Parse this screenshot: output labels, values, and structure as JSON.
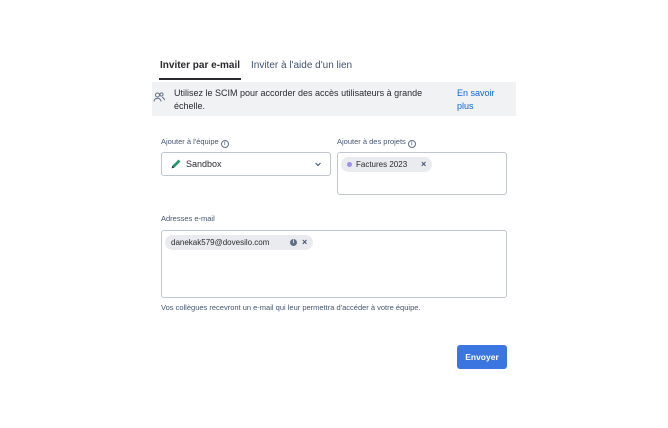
{
  "tabs": [
    {
      "label": "Inviter par e-mail",
      "active": true
    },
    {
      "label": "Inviter à l'aide d'un lien",
      "active": false
    }
  ],
  "banner": {
    "icon": "users-icon",
    "text": "Utilisez le SCIM pour accorder des accès utilisateurs à grande échelle.",
    "link": "En savoir plus"
  },
  "team": {
    "label": "Ajouter à l'équipe",
    "info_icon": "info-icon",
    "icon": "pencil-icon",
    "value": "Sandbox"
  },
  "projects": {
    "label": "Ajouter à des projets",
    "info_icon": "info-icon",
    "chips": [
      {
        "label": "Factures 2023",
        "color": "#9f8fef"
      }
    ]
  },
  "emails": {
    "label": "Adresses e-mail",
    "chips": [
      {
        "label": "danekak579@dovesilo.com"
      }
    ],
    "help": "Vos collègues recevront un e-mail qui leur permettra d'accéder à votre équipe."
  },
  "actions": {
    "submit": "Envoyer",
    "accent": "#3a75e0"
  }
}
